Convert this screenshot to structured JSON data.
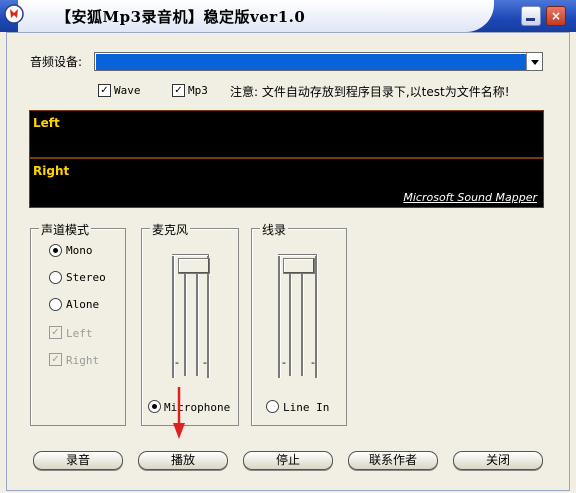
{
  "window": {
    "title": "【安狐Mp3录音机】稳定版ver1.0"
  },
  "device": {
    "label": "音频设备:",
    "selected": ""
  },
  "formats": {
    "wave": "Wave",
    "mp3": "Mp3",
    "notice": "注意: 文件自动存放到程序目录下,以test为文件名称!"
  },
  "meters": {
    "left": "Left",
    "right": "Right",
    "device_name": "Microsoft Sound Mapper"
  },
  "channel": {
    "title": "声道模式",
    "options": [
      "Mono",
      "Stereo",
      "Alone"
    ],
    "selected": "Mono",
    "sub": [
      "Left",
      "Right"
    ]
  },
  "mic": {
    "title": "麦克风",
    "radio": "Microphone",
    "selected": true
  },
  "line": {
    "title": "线录",
    "radio": "Line In",
    "selected": false
  },
  "buttons": {
    "record": "录音",
    "play": "播放",
    "stop": "停止",
    "contact": "联系作者",
    "close": "关闭"
  },
  "colors": {
    "title_bar": "#1d47b5",
    "combo_fill": "#0a62d8",
    "meter_bg": "#000000",
    "meter_label": "#ffd400",
    "annotation_arrow": "#e02020"
  }
}
